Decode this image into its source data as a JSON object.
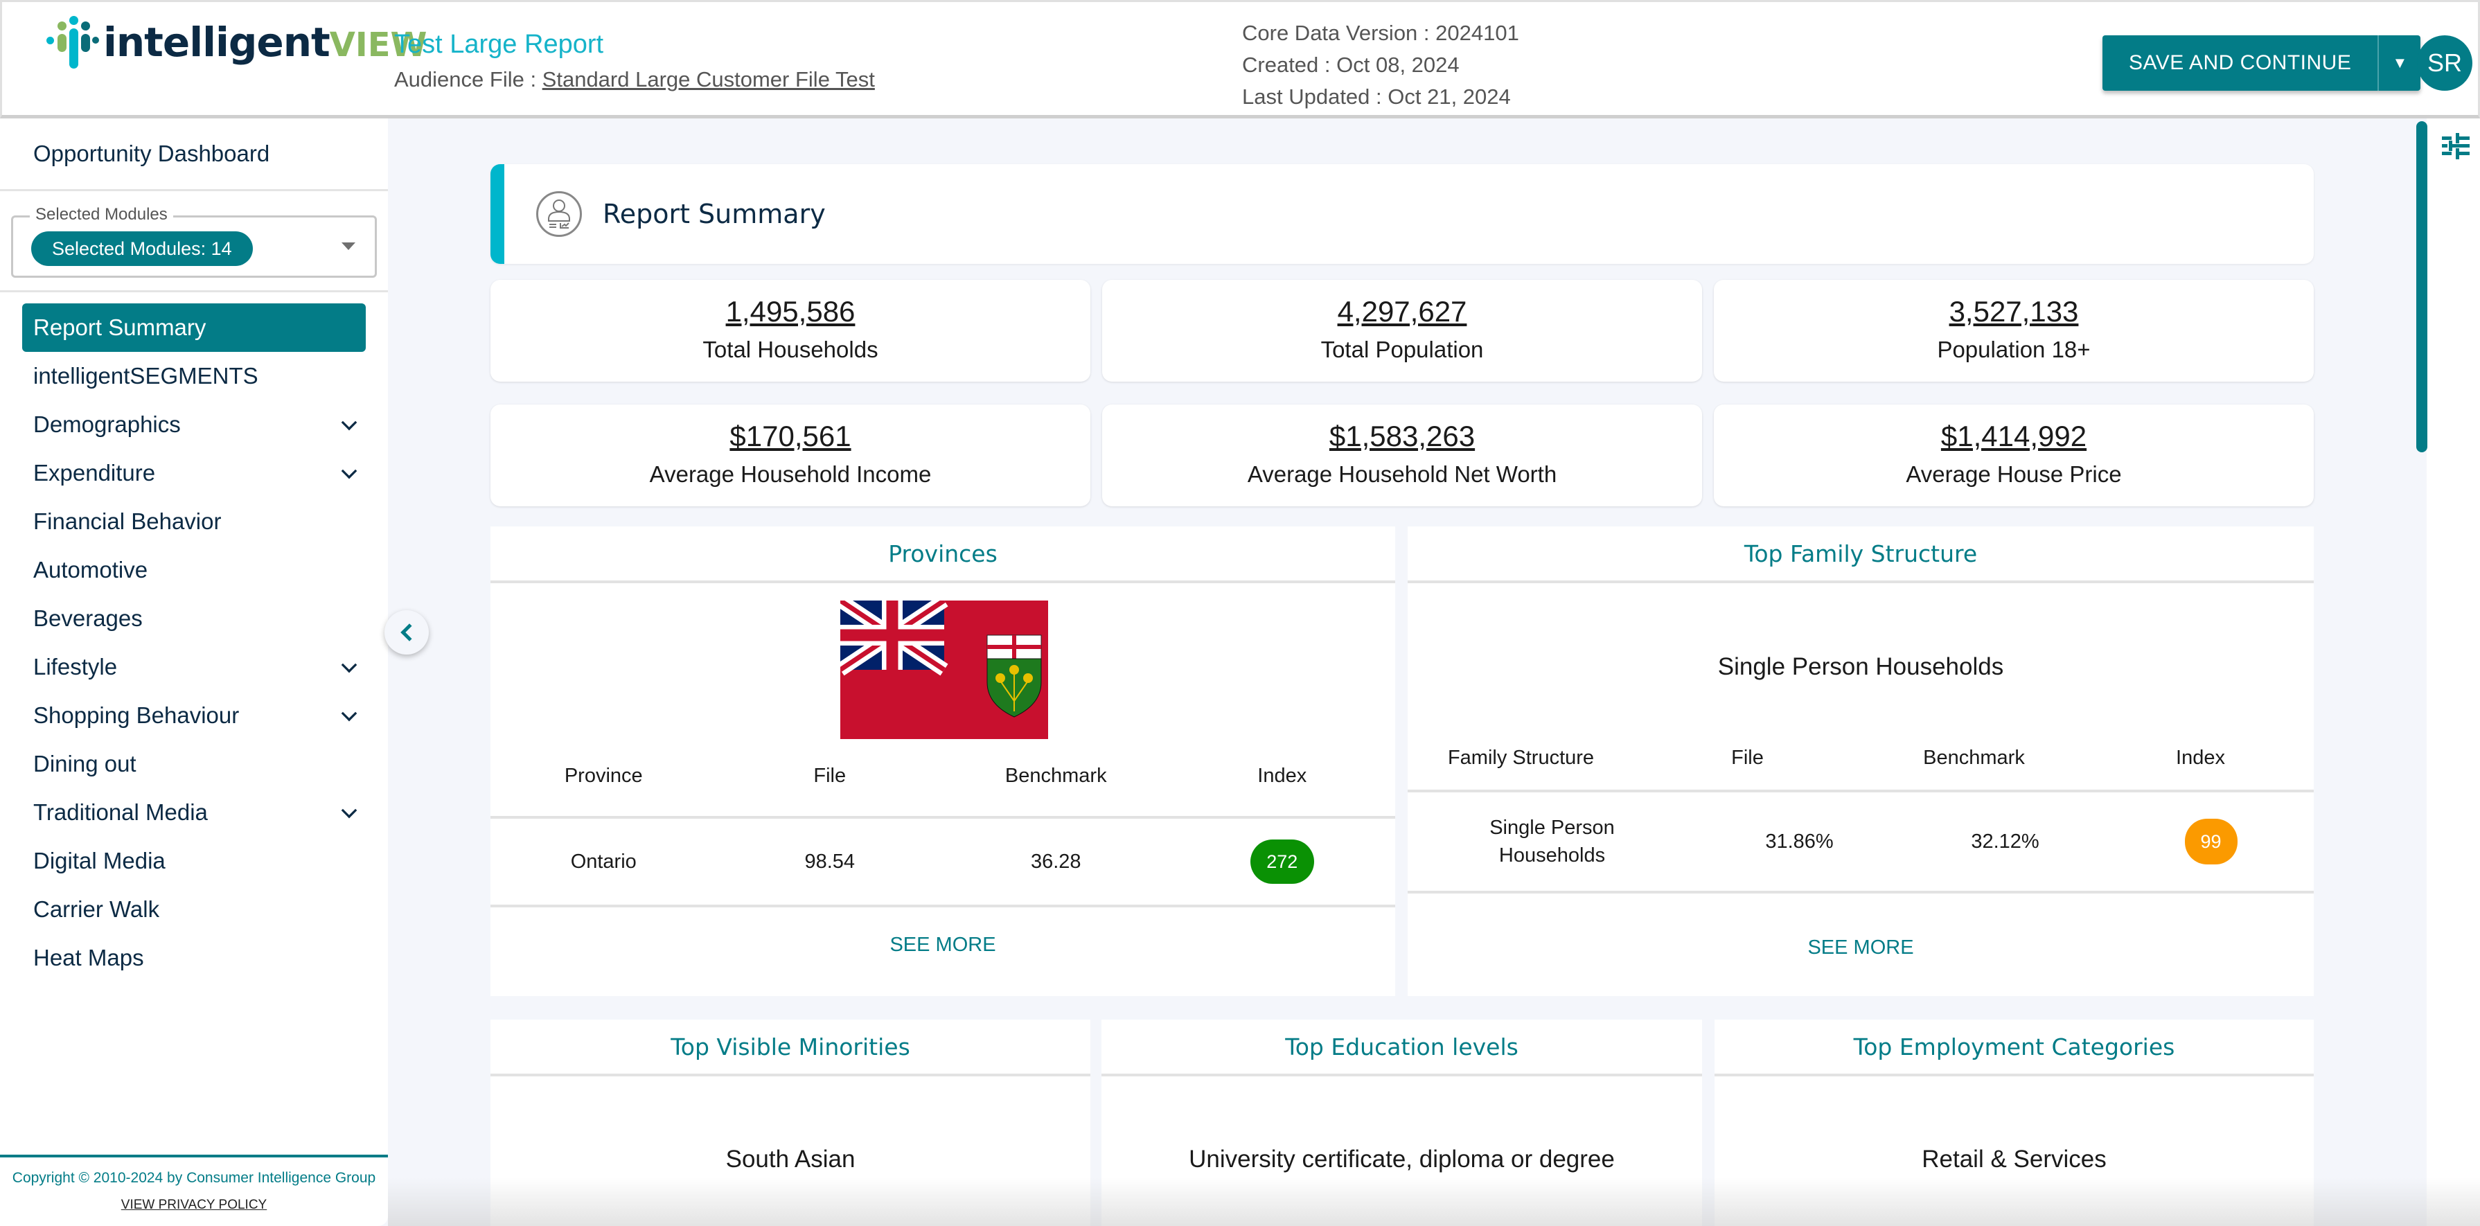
{
  "header": {
    "logo_primary": "intelligent",
    "logo_accent": "VIEW",
    "report_title": "Test Large Report",
    "audience_label": "Audience File : ",
    "audience_file": "Standard Large Customer File Test",
    "core_data_version": "Core Data Version : 2024101",
    "created": "Created : Oct 08, 2024",
    "last_updated": "Last Updated : Oct 21, 2024",
    "save_label": "SAVE AND CONTINUE",
    "save_dropdown_icon": "caret-down-icon",
    "avatar_initials": "SR"
  },
  "sidebar": {
    "top_link": "Opportunity Dashboard",
    "modules_legend": "Selected Modules",
    "modules_chip": "Selected Modules: 14",
    "items": [
      {
        "label": "Report Summary",
        "active": true,
        "expandable": false
      },
      {
        "label": "intelligentSEGMENTS",
        "active": false,
        "expandable": false
      },
      {
        "label": "Demographics",
        "active": false,
        "expandable": true
      },
      {
        "label": "Expenditure",
        "active": false,
        "expandable": true
      },
      {
        "label": "Financial Behavior",
        "active": false,
        "expandable": false
      },
      {
        "label": "Automotive",
        "active": false,
        "expandable": false
      },
      {
        "label": "Beverages",
        "active": false,
        "expandable": false
      },
      {
        "label": "Lifestyle",
        "active": false,
        "expandable": true
      },
      {
        "label": "Shopping Behaviour",
        "active": false,
        "expandable": true
      },
      {
        "label": "Dining out",
        "active": false,
        "expandable": false
      },
      {
        "label": "Traditional Media",
        "active": false,
        "expandable": true
      },
      {
        "label": "Digital Media",
        "active": false,
        "expandable": false
      },
      {
        "label": "Carrier Walk",
        "active": false,
        "expandable": false
      },
      {
        "label": "Heat Maps",
        "active": false,
        "expandable": false
      }
    ],
    "copyright": "Copyright © 2010-2024 by Consumer Intelligence Group",
    "privacy_link": "VIEW PRIVACY POLICY"
  },
  "main": {
    "section_title": "Report Summary",
    "stats": [
      {
        "value": "1,495,586",
        "label": "Total Households"
      },
      {
        "value": "4,297,627",
        "label": "Total Population"
      },
      {
        "value": "3,527,133",
        "label": "Population 18+"
      },
      {
        "value": "$170,561",
        "label": "Average Household Income"
      },
      {
        "value": "$1,583,263",
        "label": "Average Household Net Worth"
      },
      {
        "value": "$1,414,992",
        "label": "Average House Price"
      }
    ],
    "provinces": {
      "title": "Provinces",
      "flag": "ontario-flag",
      "columns": [
        "Province",
        "File",
        "Benchmark",
        "Index"
      ],
      "rows": [
        {
          "name": "Ontario",
          "file": "98.54",
          "benchmark": "36.28",
          "index": "272",
          "index_color": "#0a9104"
        }
      ],
      "see_more": "SEE MORE"
    },
    "family": {
      "title": "Top Family Structure",
      "top_value": "Single Person Households",
      "columns": [
        "Family Structure",
        "File",
        "Benchmark",
        "Index"
      ],
      "rows": [
        {
          "name": "Single Person Households",
          "file": "31.86%",
          "benchmark": "32.12%",
          "index": "99",
          "index_color": "#fb9a00"
        }
      ],
      "see_more": "SEE MORE"
    },
    "bottom_cards": [
      {
        "title": "Top Visible Minorities",
        "value": "South Asian"
      },
      {
        "title": "Top Education levels",
        "value": "University certificate, diploma or degree"
      },
      {
        "title": "Top Employment Categories",
        "value": "Retail & Services"
      }
    ]
  },
  "colors": {
    "primary": "#037c87",
    "accent": "#00b6cc",
    "index_high": "#0a9104",
    "index_mid": "#fb9a00"
  }
}
